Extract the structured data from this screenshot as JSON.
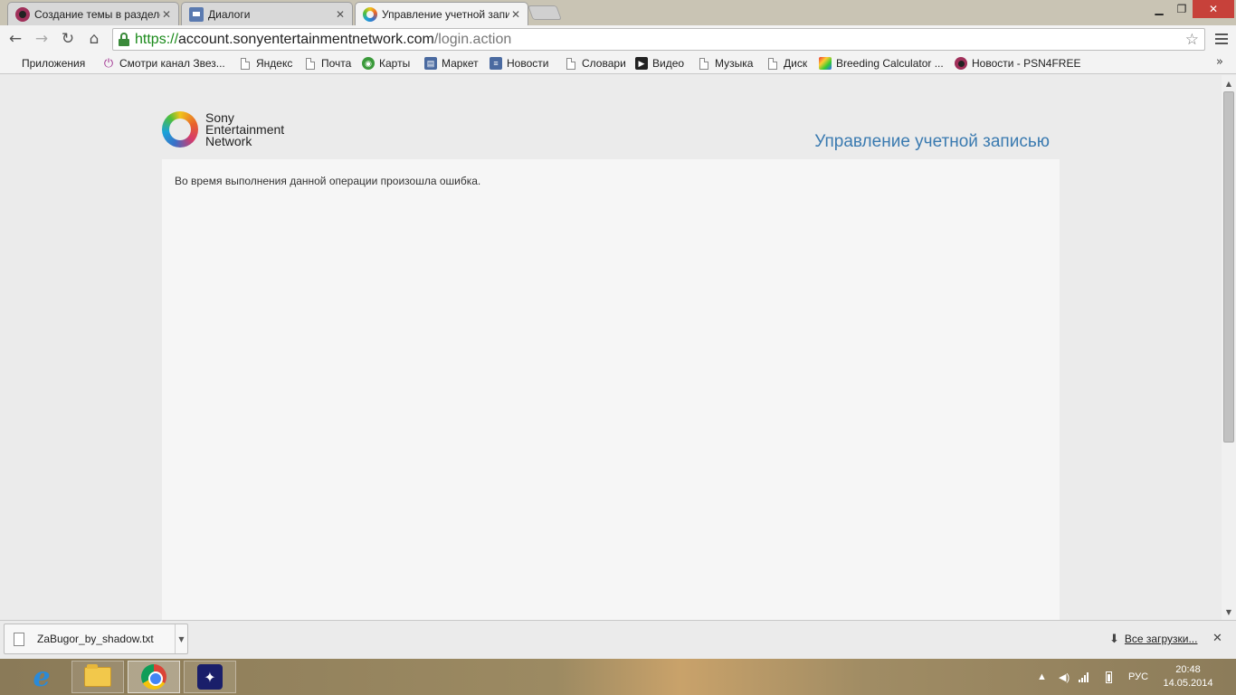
{
  "browser": {
    "tabs": [
      {
        "label": "Создание темы в разделе",
        "icon": "avatar-icon",
        "active": false
      },
      {
        "label": "Диалоги",
        "icon": "chat-icon",
        "active": false
      },
      {
        "label": "Управление учетной запи",
        "icon": "sen-icon",
        "active": true
      }
    ],
    "window_controls": {
      "minimize": "▁",
      "maximize": "❐",
      "close": "✕"
    },
    "address": {
      "scheme": "https://",
      "host": "account.sonyentertainmentnetwork.com",
      "path": "/login.action"
    },
    "bookmarks": [
      {
        "label": "Приложения",
        "icon": "apps-grid-icon"
      },
      {
        "label": "Смотри канал Звез...",
        "icon": "power-icon"
      },
      {
        "label": "Яндекс",
        "icon": "page-icon"
      },
      {
        "label": "Почта",
        "icon": "page-icon"
      },
      {
        "label": "Карты",
        "icon": "maps-icon"
      },
      {
        "label": "Маркет",
        "icon": "market-icon"
      },
      {
        "label": "Новости",
        "icon": "news-icon"
      },
      {
        "label": "Словари",
        "icon": "page-icon"
      },
      {
        "label": "Видео",
        "icon": "video-icon"
      },
      {
        "label": "Музыка",
        "icon": "page-icon"
      },
      {
        "label": "Диск",
        "icon": "page-icon"
      },
      {
        "label": "Breeding Calculator ...",
        "icon": "breeding-icon"
      },
      {
        "label": "Новости - PSN4FREE",
        "icon": "avatar-icon"
      }
    ],
    "bookmarks_more": "»"
  },
  "page": {
    "logo_lines": [
      "Sony",
      "Entertainment",
      "Network"
    ],
    "heading": "Управление учетной записью",
    "error_message": "Во время выполнения данной операции произошла ошибка."
  },
  "downloads": {
    "file_name": "ZaBugor_by_shadow.txt",
    "show_all": "Все загрузки...",
    "close": "✕"
  },
  "taskbar": {
    "apps": [
      "internet-explorer-icon",
      "file-explorer-icon",
      "chrome-icon",
      "game-app-icon"
    ],
    "language": "РУС",
    "time": "20:48",
    "date": "14.05.2014"
  },
  "colors": {
    "accent_heading": "#3a7ab0",
    "url_scheme": "#1a8a1a",
    "window_close": "#c7413a"
  }
}
